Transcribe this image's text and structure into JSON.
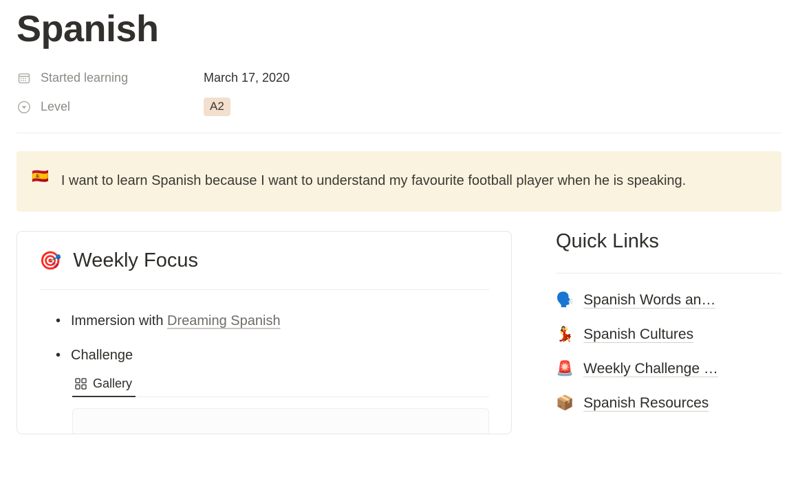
{
  "page": {
    "title": "Spanish"
  },
  "properties": [
    {
      "icon": "calendar-icon",
      "label": "Started learning",
      "value": "March 17, 2020",
      "type": "date"
    },
    {
      "icon": "select-chevron-icon",
      "label": "Level",
      "value": "A2",
      "type": "select",
      "tag_color": "#f2dfce"
    }
  ],
  "callout": {
    "emoji": "🇪🇸",
    "emoji_name": "flag-spain",
    "text": "I want to learn Spanish because I want to understand my favourite football player when he is speaking.",
    "background": "#faf3e0"
  },
  "weekly_focus": {
    "emoji": "🎯",
    "emoji_name": "direct-hit",
    "title": "Weekly Focus",
    "bullets": [
      {
        "prefix": "Immersion with ",
        "link": "Dreaming Spanish"
      },
      {
        "prefix": "Challenge",
        "link": ""
      }
    ],
    "database": {
      "tabs": [
        {
          "label": "Gallery",
          "icon": "gallery-grid-icon",
          "active": true
        }
      ]
    }
  },
  "quick_links": {
    "title": "Quick Links",
    "items": [
      {
        "emoji": "🗣️",
        "emoji_name": "speaking-head",
        "label": "Spanish Words an…"
      },
      {
        "emoji": "💃",
        "emoji_name": "woman-dancing",
        "label": "Spanish Cultures"
      },
      {
        "emoji": "🚨",
        "emoji_name": "police-car-light",
        "label": "Weekly Challenge …"
      },
      {
        "emoji": "📦",
        "emoji_name": "package",
        "label": "Spanish Resources"
      }
    ]
  }
}
